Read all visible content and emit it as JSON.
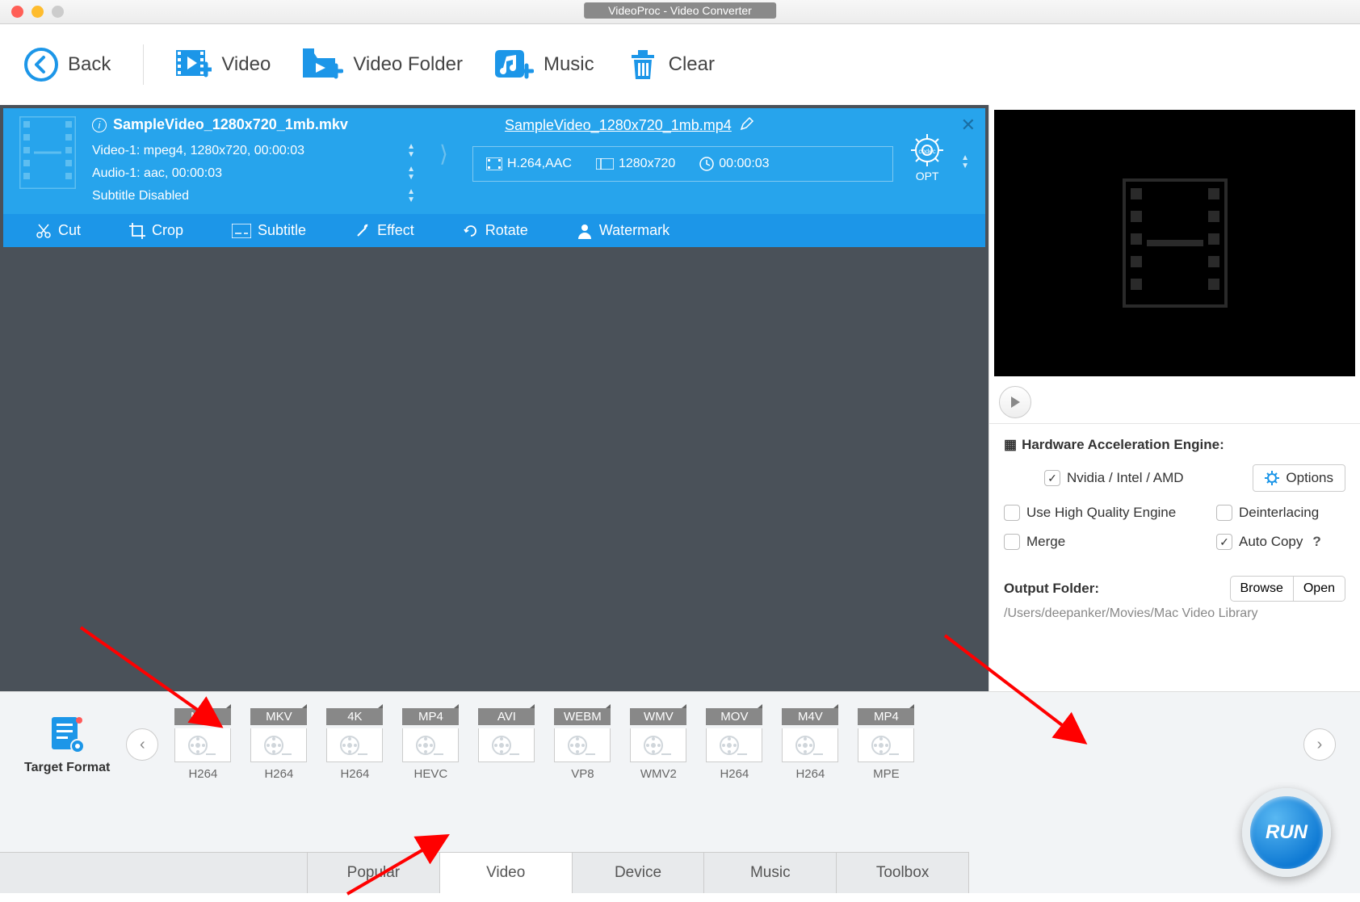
{
  "window": {
    "title": "VideoProc - Video Converter"
  },
  "toolbar": {
    "back": "Back",
    "video": "Video",
    "video_folder": "Video Folder",
    "music": "Music",
    "clear": "Clear"
  },
  "job": {
    "source_name": "SampleVideo_1280x720_1mb.mkv",
    "video_line": "Video-1: mpeg4, 1280x720, 00:00:03",
    "audio_line": "Audio-1: aac, 00:00:03",
    "subtitle_line": "Subtitle Disabled",
    "output_name": "SampleVideo_1280x720_1mb.mp4",
    "out_codec": "H.264,AAC",
    "out_res": "1280x720",
    "out_dur": "00:00:03",
    "opt_label": "OPT",
    "tools": {
      "cut": "Cut",
      "crop": "Crop",
      "subtitle": "Subtitle",
      "effect": "Effect",
      "rotate": "Rotate",
      "watermark": "Watermark"
    }
  },
  "right": {
    "hw_title": "Hardware Acceleration Engine:",
    "gpu": "Nvidia / Intel / AMD",
    "options": "Options",
    "hq": "Use High Quality Engine",
    "deint": "Deinterlacing",
    "merge": "Merge",
    "autocopy": "Auto Copy",
    "out_folder_label": "Output Folder:",
    "browse": "Browse",
    "open": "Open",
    "out_folder_path": "/Users/deepanker/Movies/Mac Video Library"
  },
  "formats": {
    "target_label": "Target Format",
    "items": [
      {
        "fmt": "MP4",
        "sub": "H264"
      },
      {
        "fmt": "MKV",
        "sub": "H264"
      },
      {
        "fmt": "4K",
        "sub": "H264"
      },
      {
        "fmt": "MP4",
        "sub": "HEVC"
      },
      {
        "fmt": "AVI",
        "sub": ""
      },
      {
        "fmt": "WEBM",
        "sub": "VP8"
      },
      {
        "fmt": "WMV",
        "sub": "WMV2"
      },
      {
        "fmt": "MOV",
        "sub": "H264"
      },
      {
        "fmt": "M4V",
        "sub": "H264"
      },
      {
        "fmt": "MP4",
        "sub": "MPE"
      }
    ]
  },
  "tabs": {
    "popular": "Popular",
    "video": "Video",
    "device": "Device",
    "music": "Music",
    "toolbox": "Toolbox"
  },
  "run": "RUN"
}
